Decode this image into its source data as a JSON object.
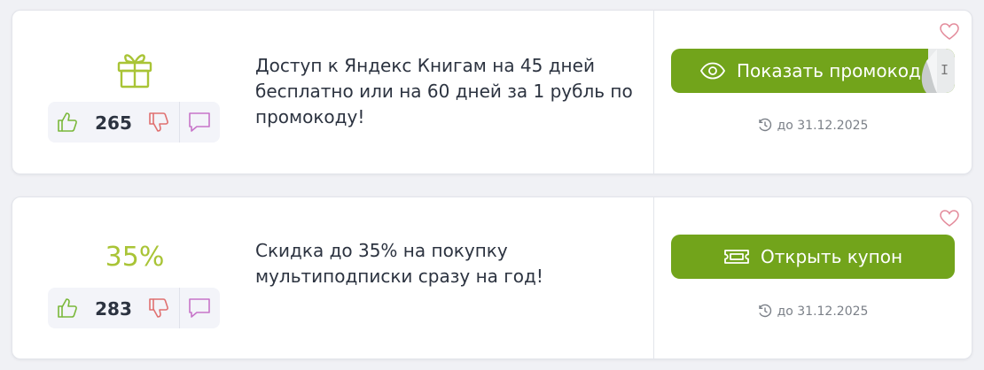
{
  "offers": [
    {
      "icon": "gift-icon",
      "votes": "265",
      "title": "Доступ к Яндекс Книгам на 45 дней бесплатно или на 60 дней за 1 рубль по промокоду!",
      "button_label": "Показать промокод",
      "button_icon": "eye-icon",
      "code_peek": "I",
      "expiry": "до 31.12.2025"
    },
    {
      "discount": "35%",
      "votes": "283",
      "title": "Скидка до 35% на покупку мультиподписки сразу на год!",
      "button_label": "Открыть купон",
      "button_icon": "ticket-icon",
      "expiry": "до 31.12.2025"
    }
  ],
  "colors": {
    "accent_green": "#72a41b",
    "discount_green": "#a9c436",
    "vote_up": "#7ab83a",
    "vote_down": "#e07070",
    "comment": "#c774c9",
    "heart": "#e38a9a"
  }
}
